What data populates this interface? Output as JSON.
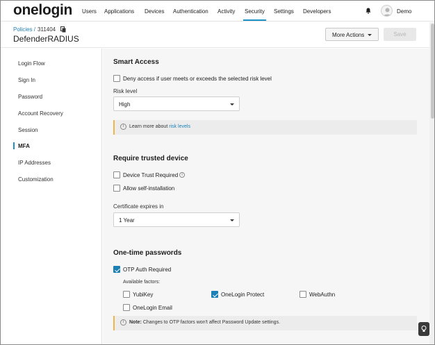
{
  "nav": {
    "logo": "onelogin",
    "logo_tm": "™",
    "items": [
      "Users",
      "Applications",
      "Devices",
      "Authentication",
      "Activity",
      "Security",
      "Settings",
      "Developers"
    ],
    "active": "Security",
    "user": "Demo"
  },
  "header": {
    "breadcrumb_link": "Policies /",
    "policy_id": "311404",
    "title": "DefenderRADIUS",
    "more_actions": "More Actions",
    "save": "Save"
  },
  "sidebar": {
    "items": [
      "Login Flow",
      "Sign In",
      "Password",
      "Account Recovery",
      "Session",
      "MFA",
      "IP Addresses",
      "Customization"
    ],
    "active": "MFA"
  },
  "smart_access": {
    "title": "Smart Access",
    "deny_label": "Deny access if user meets or exceeds the selected risk level",
    "deny_checked": false,
    "risk_level_label": "Risk level",
    "risk_level_value": "High",
    "notice_prefix": "Learn more about",
    "notice_link": "risk levels"
  },
  "trusted_device": {
    "title": "Require trusted device",
    "device_trust_label": "Device Trust Required",
    "device_trust_checked": false,
    "self_install_label": "Allow self-installation",
    "self_install_checked": false,
    "cert_label": "Certificate expires in",
    "cert_value": "1 Year"
  },
  "otp": {
    "title": "One-time passwords",
    "otp_required_label": "OTP Auth Required",
    "otp_required_checked": true,
    "factors_label": "Available factors:",
    "factors": [
      {
        "label": "YubiKey",
        "checked": false
      },
      {
        "label": "OneLogin Protect",
        "checked": true
      },
      {
        "label": "WebAuthn",
        "checked": false
      },
      {
        "label": "OneLogin Email",
        "checked": false
      }
    ],
    "note_bold": "Note:",
    "note_text": "Changes to OTP factors won't affect Password Update settings."
  },
  "colors": {
    "accent": "#1c92c8",
    "link": "#1c7fb6",
    "notice_border": "#f0b44a"
  }
}
